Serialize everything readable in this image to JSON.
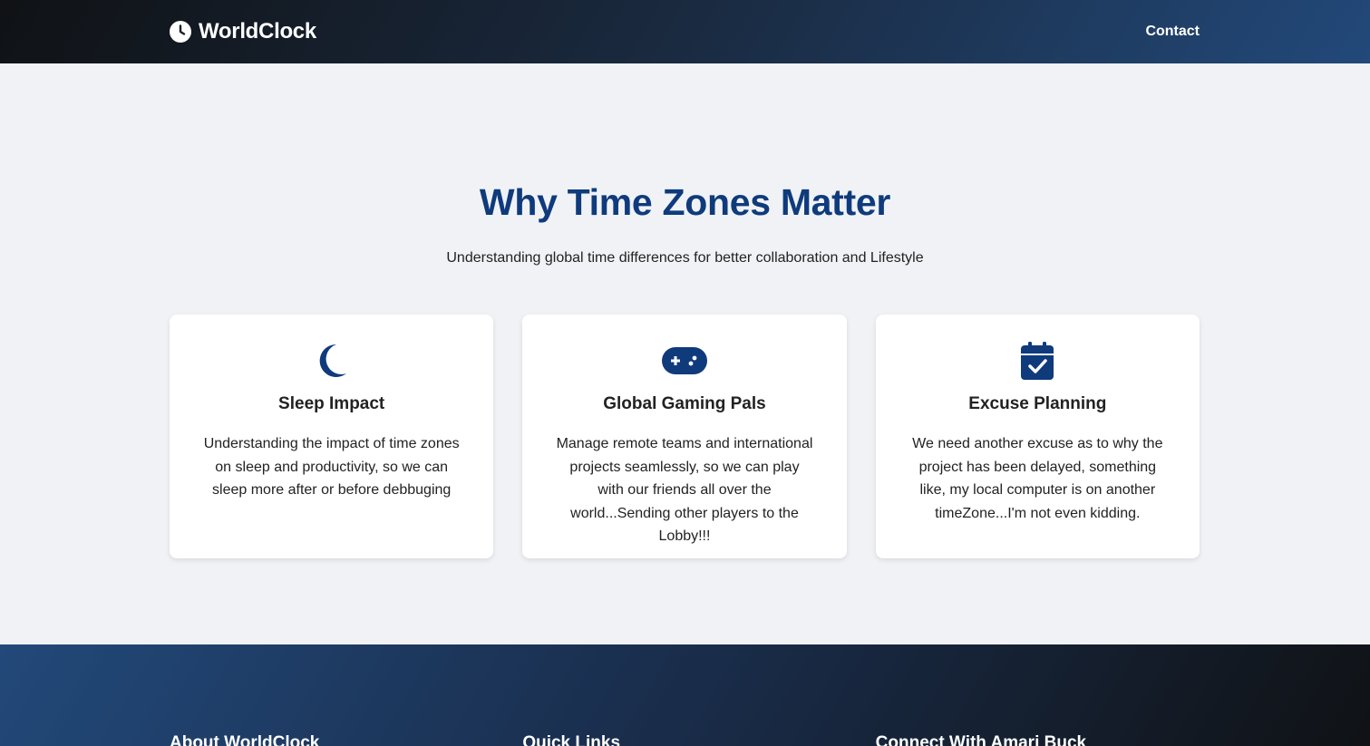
{
  "nav": {
    "brand": "WorldClock",
    "brand_icon": "clock-icon",
    "contact": "Contact"
  },
  "hero": {
    "title": "Why Time Zones Matter",
    "subtitle": "Understanding global time differences for better collaboration and Lifestyle"
  },
  "cards": [
    {
      "icon": "moon-icon",
      "title": "Sleep Impact",
      "text": "Understanding the impact of time zones on sleep and productivity, so we can sleep more after or before debbuging"
    },
    {
      "icon": "gamepad-icon",
      "title": "Global Gaming Pals",
      "text": "Manage remote teams and international projects seamlessly, so we can play with our friends all over the world...Sending other players to the Lobby!!!"
    },
    {
      "icon": "calendar-check-icon",
      "title": "Excuse Planning",
      "text": "We need another excuse as to why the project has been delayed, something like, my local computer is on another timeZone...I'm not even kidding."
    }
  ],
  "footer": {
    "about_heading": "About WorldClock",
    "links_heading": "Quick Links",
    "connect_heading": "Connect With Amari Buck"
  },
  "colors": {
    "accent": "#0f3b7c",
    "background": "#f0f2f5",
    "card": "#ffffff"
  }
}
